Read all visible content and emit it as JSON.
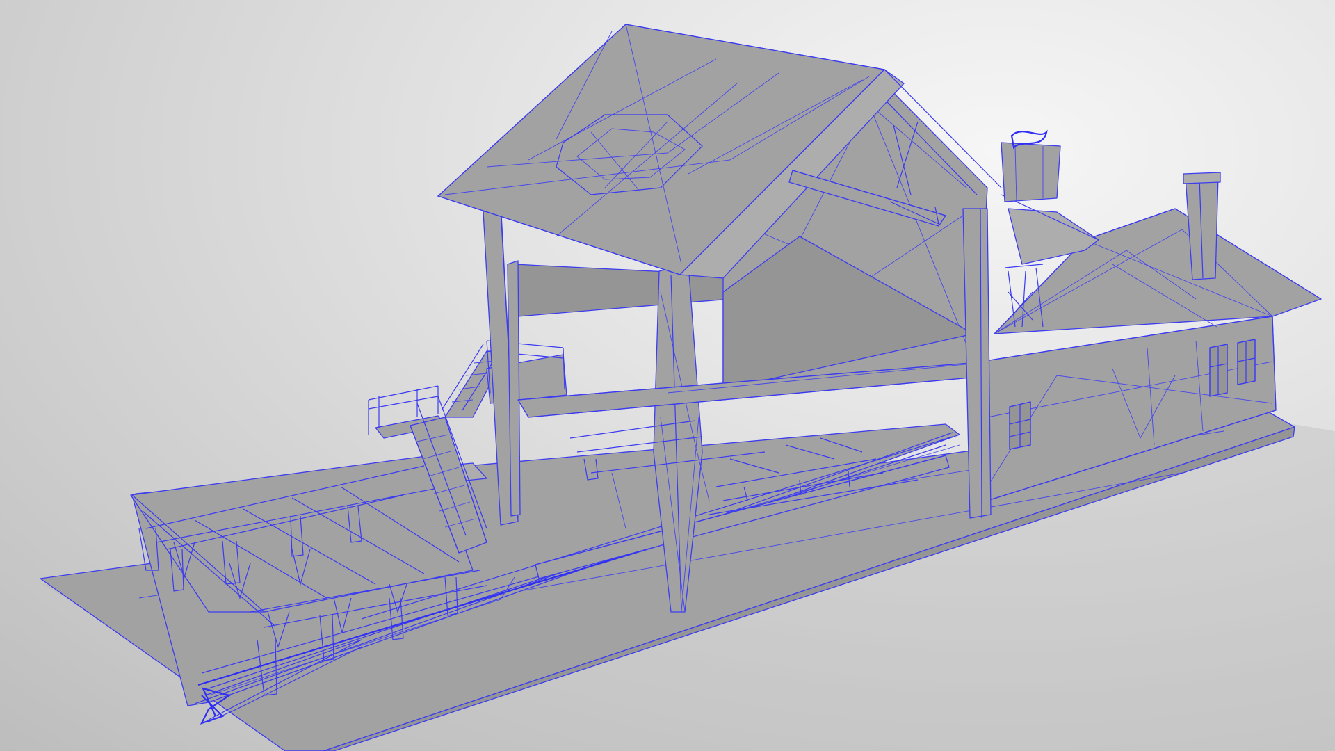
{
  "scene": {
    "object": "wireframe-model",
    "colors": {
      "background_light": "#f6f6f6",
      "background_dark": "#bdbdbd",
      "surface": "#a2a2a2",
      "wire": "#3c3cf0"
    }
  }
}
